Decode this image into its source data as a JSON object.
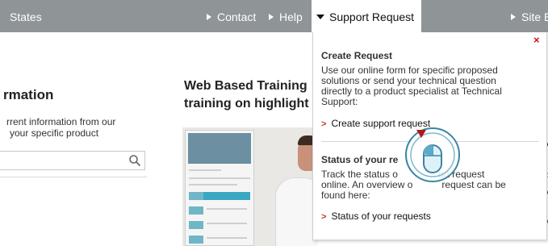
{
  "nav": {
    "states_label": "States",
    "contact_label": "Contact",
    "help_label": "Help",
    "support_request_label": "Support Request",
    "site_label": "Site E"
  },
  "left": {
    "heading": "rmation",
    "text_line1": "rrent information from our",
    "text_line2": "your specific product"
  },
  "training": {
    "line1": "Web Based Training",
    "line2": "training on highlight"
  },
  "popup": {
    "create_title": "Create Request",
    "create_line1": "Use our online form for specific proposed",
    "create_line2": "solutions or send your technical question",
    "create_line3": "directly to a product specialist at Technical",
    "create_line4": "Support:",
    "create_link": "Create support request",
    "status_title": "Status of your re",
    "status_line1": "Track the status o",
    "status_line1b": "ort request",
    "status_line2": "online. An overview o",
    "status_line2b": "request can be",
    "status_line3": "found here:",
    "status_link": "Status of your requests",
    "close_symbol": "×"
  },
  "edge": {
    "c1": "y",
    "c2": "F",
    "c3": "A",
    "c4": "A"
  },
  "colors": {
    "nav_bg": "#8f9497",
    "accent_red": "#c0392b",
    "close_red": "#cc1111",
    "cursor_blue": "#3a86a8"
  },
  "icons": [
    "search-icon",
    "close-icon",
    "chevron-right-icon",
    "caret-down-icon",
    "mouse-cursor-icon"
  ]
}
